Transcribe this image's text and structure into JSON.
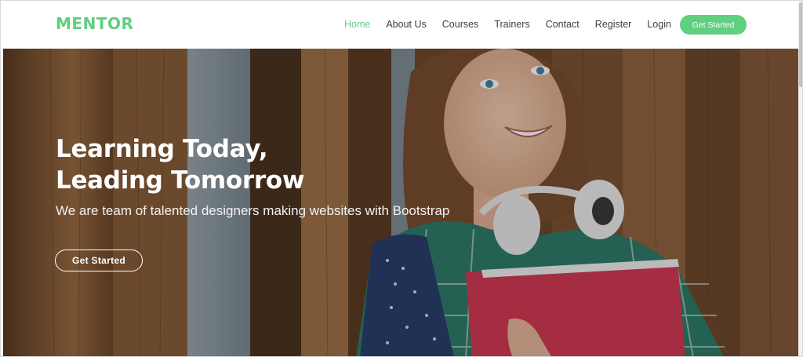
{
  "brand": {
    "logo_text": "MENTOR",
    "accent_color": "#5fcf80"
  },
  "nav": {
    "items": [
      {
        "label": "Home",
        "active": true
      },
      {
        "label": "About Us",
        "active": false
      },
      {
        "label": "Courses",
        "active": false
      },
      {
        "label": "Trainers",
        "active": false
      },
      {
        "label": "Contact",
        "active": false
      },
      {
        "label": "Register",
        "active": false
      },
      {
        "label": "Login",
        "active": false
      }
    ],
    "cta_label": "Get Started"
  },
  "hero": {
    "title_line1": "Learning Today,",
    "title_line2": "Leading Tomorrow",
    "subtitle": "We are team of talented designers making websites with Bootstrap",
    "button_label": "Get Started",
    "image_description": "smiling-student-with-headphones-and-red-folder"
  }
}
